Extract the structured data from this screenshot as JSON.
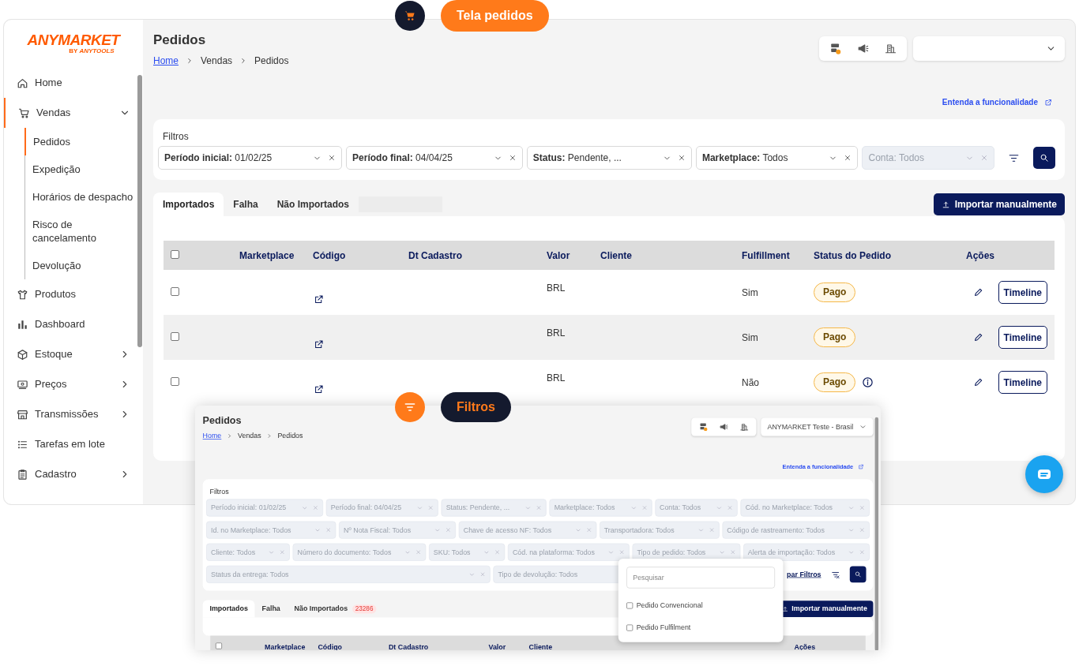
{
  "main_screen": {
    "callout": {
      "label": "Tela pedidos"
    },
    "sidebar": {
      "logo": {
        "name": "ANYMARKET",
        "by": "BY",
        "sub": "ANYTOOLS"
      },
      "items": [
        {
          "label": "Home",
          "selected": false
        },
        {
          "label": "Vendas",
          "selected": true,
          "expanded": true,
          "children": [
            {
              "label": "Pedidos",
              "selected": true
            },
            {
              "label": "Expedição",
              "selected": false
            },
            {
              "label": "Horários de despacho",
              "selected": false
            },
            {
              "label": "Risco de cancelamento",
              "selected": false
            },
            {
              "label": "Devolução",
              "selected": false
            }
          ]
        },
        {
          "label": "Produtos",
          "selected": false
        },
        {
          "label": "Dashboard",
          "selected": false
        },
        {
          "label": "Estoque",
          "selected": false,
          "expanded": false
        },
        {
          "label": "Preços",
          "selected": false,
          "expanded": false
        },
        {
          "label": "Transmissões",
          "selected": false,
          "expanded": false
        },
        {
          "label": "Tarefas em lote",
          "selected": false
        },
        {
          "label": "Cadastro",
          "selected": false,
          "expanded": false
        }
      ]
    },
    "header": {
      "title": "Pedidos",
      "breadcrumb": [
        "Home",
        "Vendas",
        "Pedidos"
      ]
    },
    "help_link": "Entenda a funcionalidade",
    "filters": {
      "title": "Filtros",
      "items": [
        {
          "label": "Período inicial:",
          "value": "01/02/25",
          "disabled": false
        },
        {
          "label": "Período final:",
          "value": "04/04/25",
          "disabled": false
        },
        {
          "label": "Status:",
          "value": "Pendente, ...",
          "disabled": false
        },
        {
          "label": "Marketplace:",
          "value": "Todos",
          "disabled": false
        },
        {
          "label": "Conta:",
          "value": "Todos",
          "disabled": true
        }
      ]
    },
    "tabs": [
      {
        "label": "Importados",
        "selected": true
      },
      {
        "label": "Falha",
        "selected": false
      },
      {
        "label": "Não Importados",
        "selected": false,
        "count_hidden": true
      }
    ],
    "import_button": "Importar manualmente",
    "table": {
      "select_all_checked": false,
      "columns": [
        "Marketplace",
        "Código",
        "Dt Cadastro",
        "Valor",
        "Cliente",
        "Fulfillment",
        "Status do Pedido",
        "Ações"
      ],
      "rows": [
        {
          "checked": false,
          "currency": "BRL",
          "fulfillment": "Sim",
          "status": "Pago",
          "info": false,
          "action": "Timeline"
        },
        {
          "checked": false,
          "currency": "BRL",
          "fulfillment": "Sim",
          "status": "Pago",
          "info": false,
          "action": "Timeline"
        },
        {
          "checked": false,
          "currency": "BRL",
          "fulfillment": "Não",
          "status": "Pago",
          "info": true,
          "action": "Timeline"
        }
      ]
    }
  },
  "filters_screen": {
    "callout": {
      "label": "Filtros"
    },
    "header": {
      "title": "Pedidos",
      "breadcrumb": [
        "Home",
        "Vendas",
        "Pedidos"
      ],
      "account": "ANYMARKET Teste - Brasil"
    },
    "help_link": "Entenda a funcionalidade",
    "filters": {
      "title": "Filtros",
      "items": [
        {
          "label": "Período inicial:",
          "value": "01/02/25",
          "disabled": true
        },
        {
          "label": "Período final:",
          "value": "04/04/25",
          "disabled": true
        },
        {
          "label": "Status:",
          "value": "Pendente, ...",
          "disabled": true
        },
        {
          "label": "Marketplace:",
          "value": "Todos",
          "disabled": true
        },
        {
          "label": "Conta:",
          "value": "Todos",
          "disabled": true
        },
        {
          "label": "Cód. no Marketplace:",
          "value": "Todos",
          "disabled": true
        },
        {
          "label": "Id. no Marketplace:",
          "value": "Todos",
          "disabled": true
        },
        {
          "label": "Nº Nota Fiscal:",
          "value": "Todos",
          "disabled": true
        },
        {
          "label": "Chave de acesso NF:",
          "value": "Todos",
          "disabled": true
        },
        {
          "label": "Transportadora:",
          "value": "Todos",
          "disabled": true
        },
        {
          "label": "Código de rastreamento:",
          "value": "Todos",
          "disabled": true
        },
        {
          "label": "Cliente:",
          "value": "Todos",
          "disabled": true
        },
        {
          "label": "Número do documento:",
          "value": "Todos",
          "disabled": true
        },
        {
          "label": "SKU:",
          "value": "Todos",
          "disabled": true
        },
        {
          "label": "Cód. na plataforma:",
          "value": "Todos",
          "disabled": true
        },
        {
          "label": "Tipo de pedido:",
          "value": "Todos",
          "disabled": true
        },
        {
          "label": "Alerta de importação:",
          "value": "Todos",
          "disabled": true
        },
        {
          "label": "Status da entrega:",
          "value": "Todos",
          "disabled": true
        },
        {
          "label": "Tipo de devolução:",
          "value": "Todos",
          "disabled": true
        }
      ],
      "clear_link": "par Filtros"
    },
    "open_dropdown": {
      "placeholder": "Pesquisar",
      "options": [
        {
          "label": "Pedido Convencional",
          "checked": false
        },
        {
          "label": "Pedido Fulfilment",
          "checked": false
        }
      ]
    },
    "tabs": [
      {
        "label": "Importados",
        "selected": true
      },
      {
        "label": "Falha",
        "selected": false
      },
      {
        "label": "Não Importados",
        "selected": false,
        "count": "23286"
      }
    ],
    "import_button": "Importar manualmente",
    "table": {
      "select_all_checked": false,
      "columns": [
        "Marketplace",
        "Código",
        "Dt Cadastro",
        "Valor",
        "Cliente",
        "Ações"
      ]
    }
  }
}
